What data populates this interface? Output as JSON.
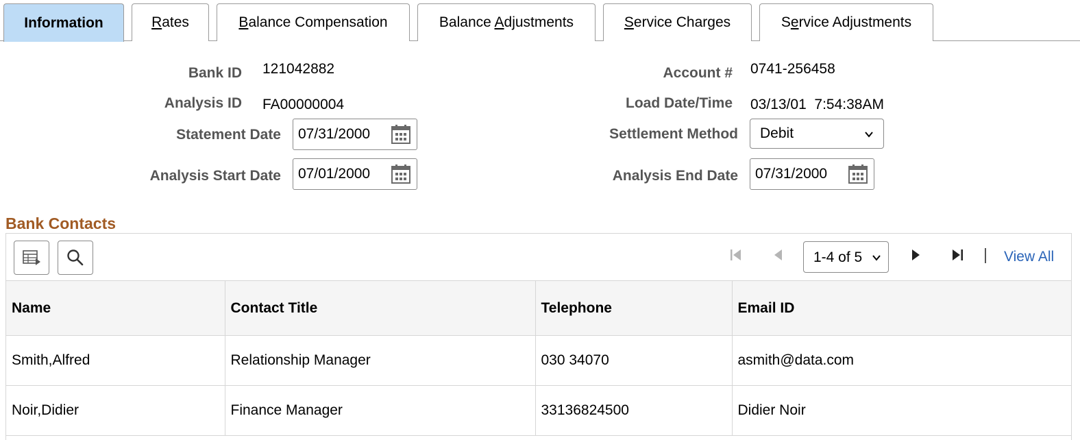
{
  "tabs": [
    {
      "prefix": "",
      "ul": "",
      "suffix": "Information"
    },
    {
      "prefix": "",
      "ul": "R",
      "suffix": "ates"
    },
    {
      "prefix": "",
      "ul": "B",
      "suffix": "alance Compensation"
    },
    {
      "prefix": "Balance ",
      "ul": "A",
      "suffix": "djustments"
    },
    {
      "prefix": "",
      "ul": "S",
      "suffix": "ervice Charges"
    },
    {
      "prefix": "S",
      "ul": "e",
      "suffix": "rvice Adjustments"
    }
  ],
  "fields": {
    "bank_id": {
      "label": "Bank ID",
      "value": "121042882"
    },
    "analysis_id": {
      "label": "Analysis ID",
      "value": "FA00000004"
    },
    "statement_date": {
      "label": "Statement Date",
      "value": "07/31/2000"
    },
    "analysis_start_date": {
      "label": "Analysis Start Date",
      "value": "07/01/2000"
    },
    "account": {
      "label": "Account #",
      "value": "0741-256458"
    },
    "load_datetime": {
      "label": "Load Date/Time",
      "value": "03/13/01  7:54:38AM"
    },
    "settlement_method": {
      "label": "Settlement Method",
      "value": "Debit"
    },
    "analysis_end_date": {
      "label": "Analysis End Date",
      "value": "07/31/2000"
    }
  },
  "contacts": {
    "title": "Bank Contacts",
    "pager": "1-4 of 5",
    "view_all": "View All",
    "columns": [
      "Name",
      "Contact Title",
      "Telephone",
      "Email ID"
    ],
    "rows": [
      [
        "Smith,Alfred",
        "Relationship Manager",
        "030 34070",
        "asmith@data.com"
      ],
      [
        "Noir,Didier",
        "Finance Manager",
        "33136824500",
        "Didier Noir"
      ]
    ]
  },
  "colors": {
    "active_tab": "#bedcf6",
    "section_title": "#a15b24",
    "link": "#2a64b8"
  },
  "icons": [
    "calendar-icon",
    "chevron-down-icon",
    "personalize-grid-icon",
    "search-icon",
    "first-page-icon",
    "previous-page-icon",
    "next-page-icon",
    "last-page-icon"
  ]
}
